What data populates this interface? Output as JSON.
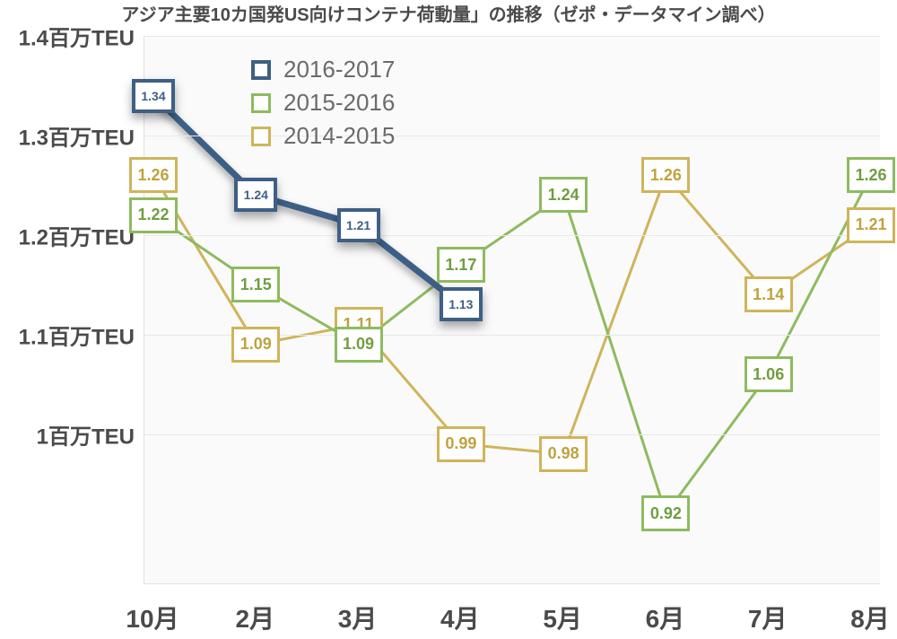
{
  "chart_data": {
    "type": "line",
    "title": "アジア主要10カ国発US向けコンテナ荷動量」の推移（ゼポ・データマイン調べ）",
    "xlabel": "",
    "ylabel": "",
    "ylim": [
      0.85,
      1.4
    ],
    "y_ticks": [
      {
        "v": 1.4,
        "label": "1.4百万TEU"
      },
      {
        "v": 1.3,
        "label": "1.3百万TEU"
      },
      {
        "v": 1.2,
        "label": "1.2百万TEU"
      },
      {
        "v": 1.1,
        "label": "1.1百万TEU"
      },
      {
        "v": 1.0,
        "label": "1百万TEU"
      }
    ],
    "categories": [
      "10月",
      "2月",
      "3月",
      "4月",
      "5月",
      "6月",
      "7月",
      "8月"
    ],
    "series": [
      {
        "name": "2016-2017",
        "color": "#3e5f86",
        "style": "blue",
        "values": [
          1.34,
          1.24,
          1.21,
          1.13,
          null,
          null,
          null,
          null
        ]
      },
      {
        "name": "2015-2016",
        "color": "#8dbb5f",
        "style": "green",
        "values": [
          1.22,
          1.15,
          1.09,
          1.17,
          1.24,
          0.92,
          1.06,
          1.26
        ]
      },
      {
        "name": "2014-2015",
        "color": "#d0b45a",
        "style": "yellow",
        "values": [
          1.26,
          1.09,
          1.11,
          0.99,
          0.98,
          1.26,
          1.14,
          1.21
        ]
      }
    ]
  },
  "legend": {
    "items": [
      {
        "label": "2016-2017",
        "style": "blue"
      },
      {
        "label": "2015-2016",
        "style": "green"
      },
      {
        "label": "2014-2015",
        "style": "yellow"
      }
    ]
  }
}
